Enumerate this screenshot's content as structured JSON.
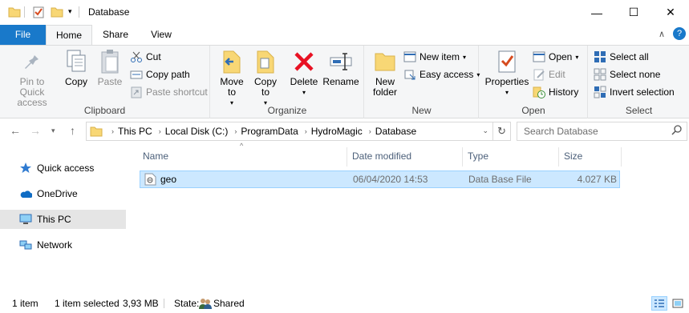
{
  "window": {
    "title": "Database",
    "minimize_glyph": "—",
    "maximize_glyph": "☐",
    "close_glyph": "✕"
  },
  "ribbon_tabs": [
    "File",
    "Home",
    "Share",
    "View"
  ],
  "ribbon": {
    "clipboard": {
      "label": "Clipboard",
      "pin": "Pin to Quick access",
      "copy": "Copy",
      "paste": "Paste",
      "cut": "Cut",
      "copy_path": "Copy path",
      "paste_shortcut": "Paste shortcut"
    },
    "organize": {
      "label": "Organize",
      "move_to": "Move to",
      "copy_to": "Copy to",
      "delete": "Delete",
      "rename": "Rename"
    },
    "new": {
      "label": "New",
      "new_folder": "New folder",
      "new_item": "New item",
      "easy_access": "Easy access"
    },
    "open": {
      "label": "Open",
      "properties": "Properties",
      "open": "Open",
      "edit": "Edit",
      "history": "History"
    },
    "select": {
      "label": "Select",
      "select_all": "Select all",
      "select_none": "Select none",
      "invert_selection": "Invert selection"
    }
  },
  "address": {
    "crumbs": [
      "This PC",
      "Local Disk (C:)",
      "ProgramData",
      "HydroMagic",
      "Database"
    ],
    "search_placeholder": "Search Database"
  },
  "navpane": {
    "items": [
      "Quick access",
      "OneDrive",
      "This PC",
      "Network"
    ]
  },
  "filelist": {
    "columns": [
      "Name",
      "Date modified",
      "Type",
      "Size"
    ],
    "rows": [
      {
        "name": "geo",
        "date": "06/04/2020 14:53",
        "type": "Data Base File",
        "size": "4.027 KB"
      }
    ]
  },
  "status": {
    "count": "1 item",
    "selected": "1 item selected",
    "selected_size": "3,93 MB",
    "state_label": "State:",
    "state_value": "Shared"
  },
  "colors": {
    "file_tab": "#1979ca",
    "selection": "#cce8ff",
    "folder": "#f8d775",
    "delete_red": "#e81123"
  }
}
